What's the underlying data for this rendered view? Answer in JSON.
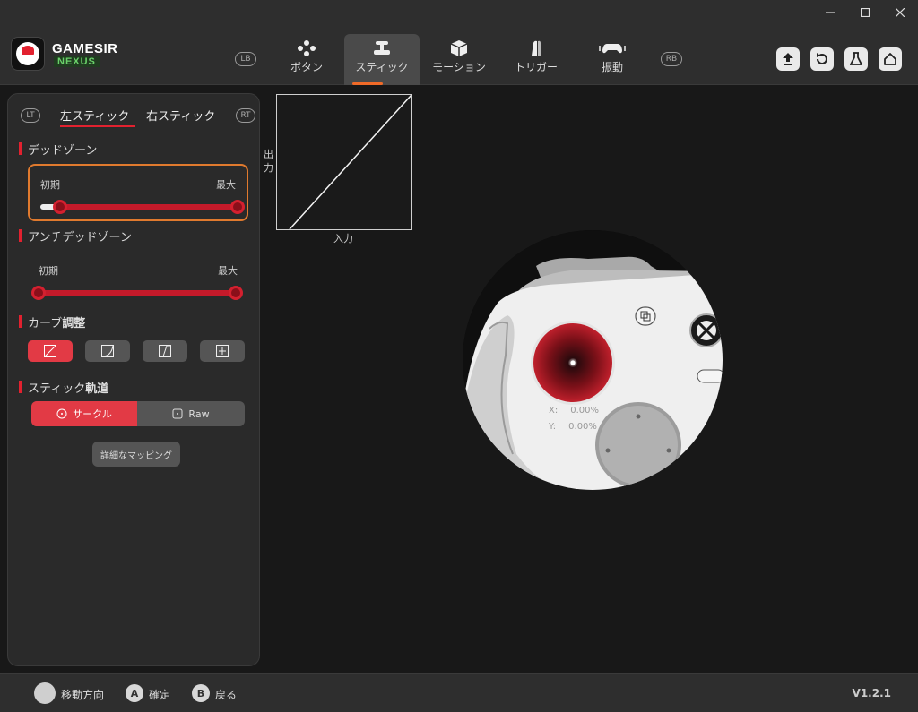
{
  "window": {
    "minimize_icon": "minimize-icon",
    "maximize_icon": "maximize-icon",
    "close_icon": "close-icon"
  },
  "brand": {
    "name": "GAMESIR",
    "sub": "NEXUS"
  },
  "nav": {
    "lb": "LB",
    "rb": "RB",
    "tabs": [
      {
        "label": "ボタン",
        "icon": "buttons-icon"
      },
      {
        "label": "スティック",
        "icon": "stick-icon"
      },
      {
        "label": "モーション",
        "icon": "motion-icon"
      },
      {
        "label": "トリガー",
        "icon": "trigger-icon"
      },
      {
        "label": "振動",
        "icon": "vibration-icon"
      }
    ],
    "active_tab": "スティック"
  },
  "header_actions": [
    "upload-icon",
    "reset-icon",
    "flask-icon",
    "home-icon"
  ],
  "panel": {
    "lt": "LT",
    "rt": "RT",
    "left_stick": "左スティック",
    "right_stick": "右スティック",
    "deadzone": {
      "title": "デッドゾーン",
      "min_label": "初期",
      "max_label": "最大",
      "range": [
        0.1,
        1.0
      ]
    },
    "anti_deadzone": {
      "title": "アンチデッドゾーン",
      "min_label": "初期",
      "max_label": "最大",
      "range": [
        0.0,
        1.0
      ]
    },
    "curve": {
      "title_a": "カーブ",
      "title_b": "調整",
      "options": [
        "linear-curve-icon",
        "concave-curve-icon",
        "s-curve-icon",
        "custom-curve-icon"
      ],
      "active_index": 0
    },
    "trajectory": {
      "title_a": "スティック",
      "title_b": "軌道",
      "circle": "サークル",
      "raw": "Raw"
    },
    "detail_mapping": "詳細なマッピング"
  },
  "graph": {
    "ylabel": "出力",
    "xlabel": "入力"
  },
  "controller": {
    "x_label": "X:",
    "x_value": "0.00%",
    "y_label": "Y:",
    "y_value": "0.00%"
  },
  "footer": {
    "move_label": "移動方向",
    "a_key": "A",
    "a_label": "確定",
    "b_key": "B",
    "b_label": "戻る",
    "version": "V1.2.1"
  },
  "colors": {
    "accent_red": "#e2212f",
    "accent_orange": "#f06a28"
  }
}
